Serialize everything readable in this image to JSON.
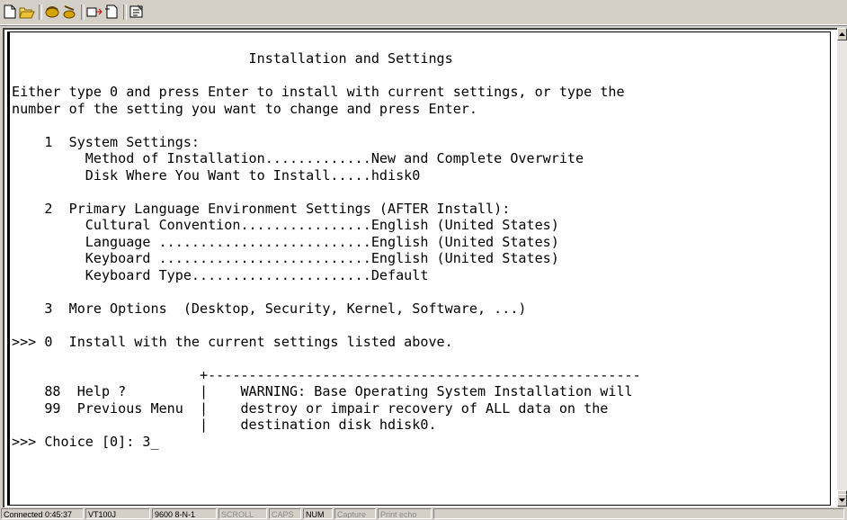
{
  "toolbar": {
    "buttons": [
      "new-icon",
      "open-icon",
      "connect-icon",
      "disconnect-icon",
      "send-icon",
      "receive-icon",
      "properties-icon"
    ]
  },
  "terminal": {
    "lines": [
      "                             Installation and Settings",
      "",
      "Either type 0 and press Enter to install with current settings, or type the",
      "number of the setting you want to change and press Enter.",
      "",
      "    1  System Settings:",
      "         Method of Installation.............New and Complete Overwrite",
      "         Disk Where You Want to Install.....hdisk0",
      "",
      "    2  Primary Language Environment Settings (AFTER Install):",
      "         Cultural Convention................English (United States)",
      "         Language ..........................English (United States)",
      "         Keyboard ..........................English (United States)",
      "         Keyboard Type......................Default",
      "",
      "    3  More Options  (Desktop, Security, Kernel, Software, ...)",
      "",
      ">>> 0  Install with the current settings listed above.",
      "",
      "                       +-----------------------------------------------------",
      "    88  Help ?         |    WARNING: Base Operating System Installation will",
      "    99  Previous Menu  |    destroy or impair recovery of ALL data on the",
      "                       |    destination disk hdisk0.",
      ">>> Choice [0]: 3_"
    ]
  },
  "status": {
    "connected": "Connected 0:45:37",
    "emulation": "VT100J",
    "port": "9600 8-N-1",
    "scroll": "SCROLL",
    "caps": "CAPS",
    "num": "NUM",
    "capture": "Capture",
    "print_echo": "Print echo"
  }
}
